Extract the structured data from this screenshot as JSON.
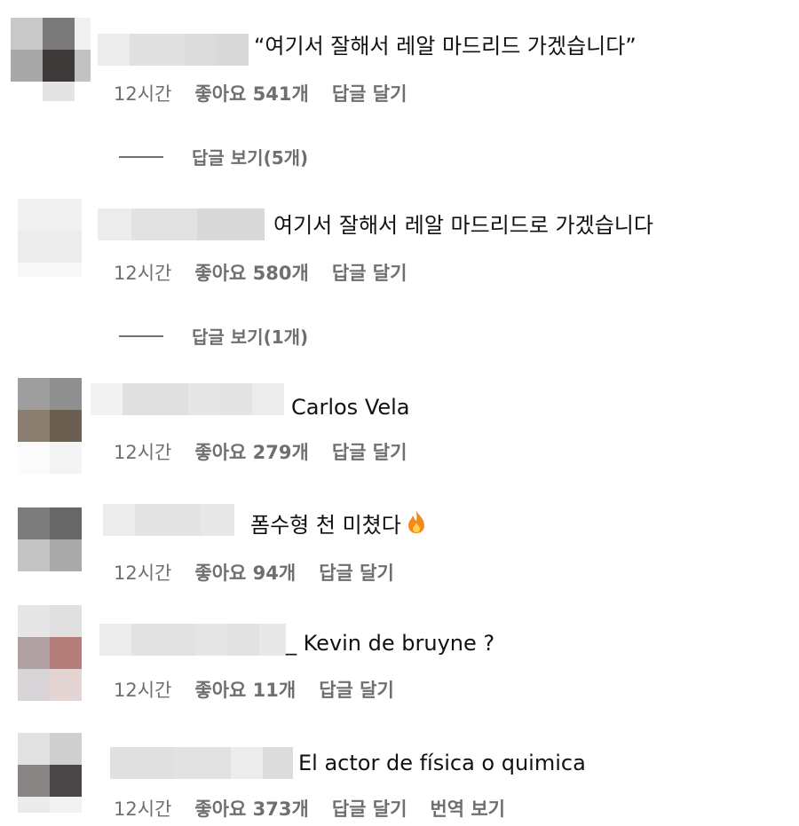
{
  "comments": [
    {
      "text": "“여기서 잘해서 레알 마드리드 가겠습니다”",
      "time": "12시간",
      "likes": "좋아요 541개",
      "reply": "답글 달기",
      "view_replies": "답글 보기(5개)"
    },
    {
      "text": "여기서 잘해서 레알 마드리드로 가겠습니다",
      "time": "12시간",
      "likes": "좋아요 580개",
      "reply": "답글 달기",
      "view_replies": "답글 보기(1개)"
    },
    {
      "text": "Carlos Vela",
      "time": "12시간",
      "likes": "좋아요 279개",
      "reply": "답글 달기"
    },
    {
      "text": "폼수형 천 미쳤다",
      "emoji": "fire-icon",
      "time": "12시간",
      "likes": "좋아요 94개",
      "reply": "답글 달기"
    },
    {
      "text": "_ Kevin de bruyne ?",
      "time": "12시간",
      "likes": "좋아요 11개",
      "reply": "답글 달기"
    },
    {
      "text": "El actor de física o quimica",
      "time": "12시간",
      "likes": "좋아요 373개",
      "reply": "답글 달기",
      "translate": "번역 보기"
    }
  ],
  "colors": {
    "meta_text": "#6f6f6f",
    "fire": "#f28b1c"
  }
}
